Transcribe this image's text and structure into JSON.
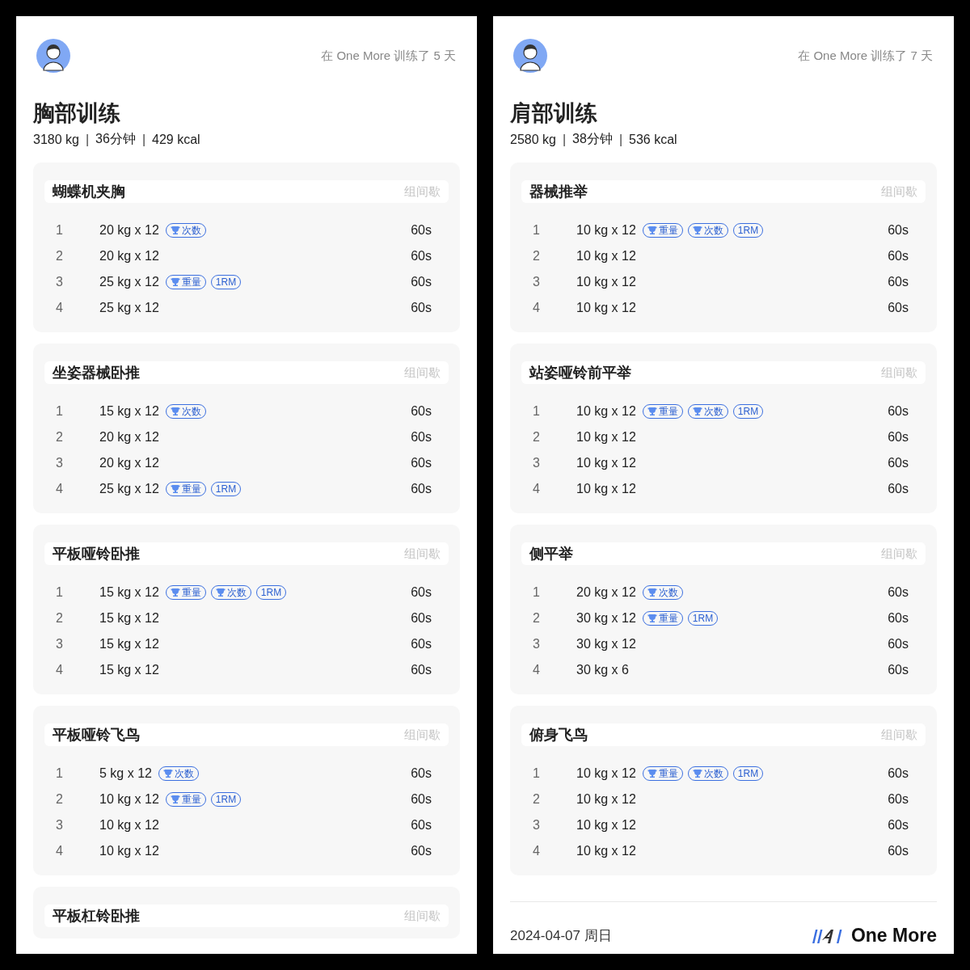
{
  "panels": [
    {
      "trained_days": "在 One More 训练了 5 天",
      "title": "胸部训练",
      "stats": [
        "3180 kg",
        "36分钟",
        "429 kcal"
      ],
      "stat_separator": "|",
      "exercises": [
        {
          "name": "蝴蝶机夹胸",
          "rest_label": "组间歇",
          "sets": [
            {
              "index": "1",
              "load": "20 kg x 12",
              "badges": [
                {
                  "kind": "reps",
                  "text": "次数"
                }
              ],
              "rest": "60s"
            },
            {
              "index": "2",
              "load": "20 kg x 12",
              "rest": "60s"
            },
            {
              "index": "3",
              "load": "25 kg x 12",
              "badges": [
                {
                  "kind": "weight",
                  "text": "重量"
                },
                {
                  "kind": "onerm",
                  "text": "1RM"
                }
              ],
              "rest": "60s"
            },
            {
              "index": "4",
              "load": "25 kg x 12",
              "rest": "60s"
            }
          ]
        },
        {
          "name": "坐姿器械卧推",
          "rest_label": "组间歇",
          "sets": [
            {
              "index": "1",
              "load": "15 kg x 12",
              "badges": [
                {
                  "kind": "reps",
                  "text": "次数"
                }
              ],
              "rest": "60s"
            },
            {
              "index": "2",
              "load": "20 kg x 12",
              "rest": "60s"
            },
            {
              "index": "3",
              "load": "20 kg x 12",
              "rest": "60s"
            },
            {
              "index": "4",
              "load": "25 kg x 12",
              "badges": [
                {
                  "kind": "weight",
                  "text": "重量"
                },
                {
                  "kind": "onerm",
                  "text": "1RM"
                }
              ],
              "rest": "60s"
            }
          ]
        },
        {
          "name": "平板哑铃卧推",
          "rest_label": "组间歇",
          "sets": [
            {
              "index": "1",
              "load": "15 kg x 12",
              "badges": [
                {
                  "kind": "weight",
                  "text": "重量"
                },
                {
                  "kind": "reps",
                  "text": "次数"
                },
                {
                  "kind": "onerm",
                  "text": "1RM"
                }
              ],
              "rest": "60s"
            },
            {
              "index": "2",
              "load": "15 kg x 12",
              "rest": "60s"
            },
            {
              "index": "3",
              "load": "15 kg x 12",
              "rest": "60s"
            },
            {
              "index": "4",
              "load": "15 kg x 12",
              "rest": "60s"
            }
          ]
        },
        {
          "name": "平板哑铃飞鸟",
          "rest_label": "组间歇",
          "sets": [
            {
              "index": "1",
              "load": "5 kg x 12",
              "badges": [
                {
                  "kind": "reps",
                  "text": "次数"
                }
              ],
              "rest": "60s"
            },
            {
              "index": "2",
              "load": "10 kg x 12",
              "badges": [
                {
                  "kind": "weight",
                  "text": "重量"
                },
                {
                  "kind": "onerm",
                  "text": "1RM"
                }
              ],
              "rest": "60s"
            },
            {
              "index": "3",
              "load": "10 kg x 12",
              "rest": "60s"
            },
            {
              "index": "4",
              "load": "10 kg x 12",
              "rest": "60s"
            }
          ]
        },
        {
          "name": "平板杠铃卧推",
          "rest_label": "组间歇"
        }
      ]
    },
    {
      "trained_days": "在 One More 训练了 7 天",
      "title": "肩部训练",
      "stats": [
        "2580 kg",
        "38分钟",
        "536 kcal"
      ],
      "stat_separator": "|",
      "exercises": [
        {
          "name": "器械推举",
          "rest_label": "组间歇",
          "sets": [
            {
              "index": "1",
              "load": "10 kg x 12",
              "badges": [
                {
                  "kind": "weight",
                  "text": "重量"
                },
                {
                  "kind": "reps",
                  "text": "次数"
                },
                {
                  "kind": "onerm",
                  "text": "1RM"
                }
              ],
              "rest": "60s"
            },
            {
              "index": "2",
              "load": "10 kg x 12",
              "rest": "60s"
            },
            {
              "index": "3",
              "load": "10 kg x 12",
              "rest": "60s"
            },
            {
              "index": "4",
              "load": "10 kg x 12",
              "rest": "60s"
            }
          ]
        },
        {
          "name": "站姿哑铃前平举",
          "rest_label": "组间歇",
          "sets": [
            {
              "index": "1",
              "load": "10 kg x 12",
              "badges": [
                {
                  "kind": "weight",
                  "text": "重量"
                },
                {
                  "kind": "reps",
                  "text": "次数"
                },
                {
                  "kind": "onerm",
                  "text": "1RM"
                }
              ],
              "rest": "60s"
            },
            {
              "index": "2",
              "load": "10 kg x 12",
              "rest": "60s"
            },
            {
              "index": "3",
              "load": "10 kg x 12",
              "rest": "60s"
            },
            {
              "index": "4",
              "load": "10 kg x 12",
              "rest": "60s"
            }
          ]
        },
        {
          "name": "侧平举",
          "rest_label": "组间歇",
          "sets": [
            {
              "index": "1",
              "load": "20 kg x 12",
              "badges": [
                {
                  "kind": "reps",
                  "text": "次数"
                }
              ],
              "rest": "60s"
            },
            {
              "index": "2",
              "load": "30 kg x 12",
              "badges": [
                {
                  "kind": "weight",
                  "text": "重量"
                },
                {
                  "kind": "onerm",
                  "text": "1RM"
                }
              ],
              "rest": "60s"
            },
            {
              "index": "3",
              "load": "30 kg x 12",
              "rest": "60s"
            },
            {
              "index": "4",
              "load": "30 kg x 6",
              "rest": "60s"
            }
          ]
        },
        {
          "name": "俯身飞鸟",
          "rest_label": "组间歇",
          "sets": [
            {
              "index": "1",
              "load": "10 kg x 12",
              "badges": [
                {
                  "kind": "weight",
                  "text": "重量"
                },
                {
                  "kind": "reps",
                  "text": "次数"
                },
                {
                  "kind": "onerm",
                  "text": "1RM"
                }
              ],
              "rest": "60s"
            },
            {
              "index": "2",
              "load": "10 kg x 12",
              "rest": "60s"
            },
            {
              "index": "3",
              "load": "10 kg x 12",
              "rest": "60s"
            },
            {
              "index": "4",
              "load": "10 kg x 12",
              "rest": "60s"
            }
          ]
        }
      ],
      "footer": {
        "date": "2024-04-07 周日",
        "brand": "One More"
      }
    }
  ]
}
